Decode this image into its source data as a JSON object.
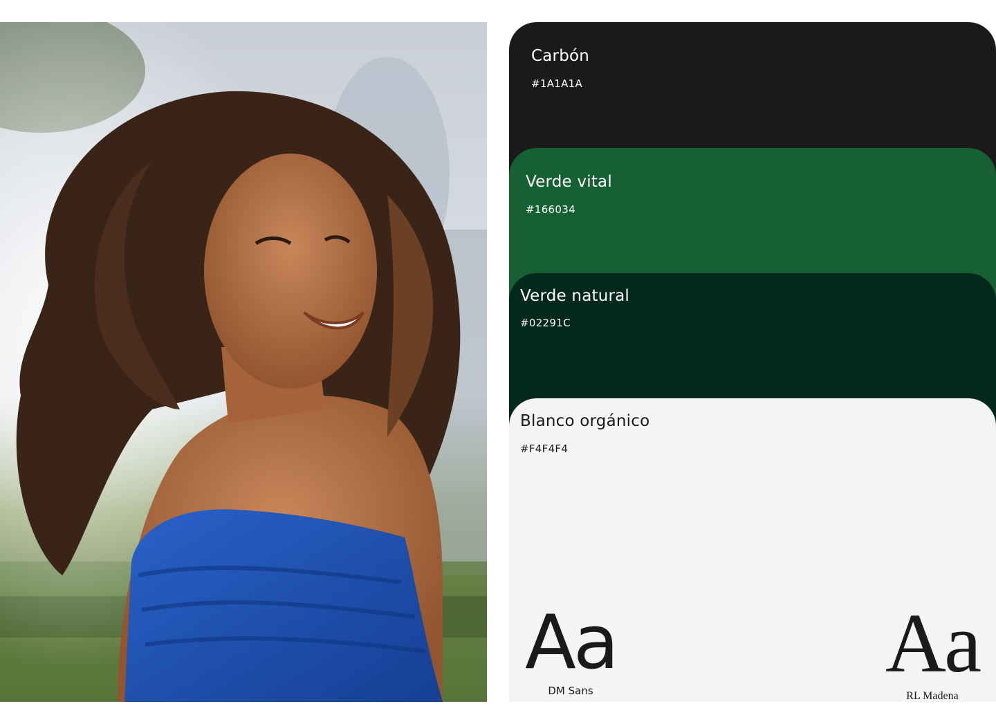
{
  "photo": {
    "icon": "portrait-photo",
    "colors": {
      "sky": "#d9dde3",
      "greenery": "#6b8a4a",
      "hair": "#3a2418",
      "skin": "#b8744a",
      "top": "#1b4fb0"
    }
  },
  "palette": {
    "swatches": [
      {
        "name": "Carbón",
        "hex": "#1A1A1A",
        "text_color": "#ffffff"
      },
      {
        "name": "Verde vital",
        "hex": "#166034",
        "text_color": "#ffffff"
      },
      {
        "name": "Verde natural",
        "hex": "#02291C",
        "text_color": "#ffffff"
      },
      {
        "name": "Blanco orgánico",
        "hex": "#F4F4F4",
        "text_color": "#1a1a1a"
      }
    ]
  },
  "typography": {
    "primary": {
      "sample": "Aa",
      "font_name": "DM Sans"
    },
    "secondary": {
      "sample": "Aa",
      "font_name": "RL Madena"
    }
  }
}
